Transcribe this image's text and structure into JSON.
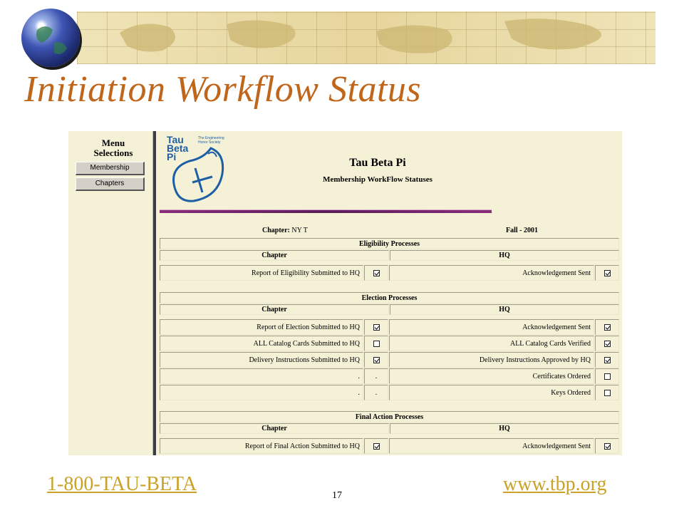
{
  "slide": {
    "title": "Initiation Workflow Status",
    "footer_phone": "1-800-TAU-BETA",
    "footer_url": "www.tbp.org",
    "page_number": "17"
  },
  "menu": {
    "heading_line1": "Menu",
    "heading_line2": "Selections",
    "items": [
      {
        "label": "Membership"
      },
      {
        "label": "Chapters"
      }
    ]
  },
  "logo": {
    "line1": "Tau",
    "line2": "Beta",
    "line3": "Pi",
    "tagline": "The Engineering Honor Society"
  },
  "header": {
    "org_name": "Tau Beta Pi",
    "subtitle": "Membership WorkFlow Statuses",
    "chapter_label": "Chapter:",
    "chapter_value": "NY T",
    "term": "Fall - 2001"
  },
  "sections": [
    {
      "title": "Eligibility Processes",
      "col_chapter": "Chapter",
      "col_hq": "HQ",
      "rows": [
        {
          "chapter_text": "Report of Eligibility Submitted to HQ",
          "chapter_checked": true,
          "hq_text": "Acknowledgement Sent",
          "hq_checked": true
        }
      ]
    },
    {
      "title": "Election Processes",
      "col_chapter": "Chapter",
      "col_hq": "HQ",
      "rows": [
        {
          "chapter_text": "Report of Election Submitted to HQ",
          "chapter_checked": true,
          "hq_text": "Acknowledgement Sent",
          "hq_checked": true
        },
        {
          "chapter_text": "ALL Catalog Cards Submitted to HQ",
          "chapter_checked": false,
          "hq_text": "ALL Catalog Cards Verified",
          "hq_checked": true
        },
        {
          "chapter_text": "Delivery Instructions Submitted to HQ",
          "chapter_checked": true,
          "hq_text": "Delivery Instructions Approved by HQ",
          "hq_checked": true
        },
        {
          "chapter_text": ".",
          "chapter_checked": null,
          "chapter_box_text": ".",
          "hq_text": "Certificates Ordered",
          "hq_checked": false
        },
        {
          "chapter_text": ".",
          "chapter_checked": null,
          "chapter_box_text": ".",
          "hq_text": "Keys Ordered",
          "hq_checked": false
        }
      ]
    },
    {
      "title": "Final Action Processes",
      "col_chapter": "Chapter",
      "col_hq": "HQ",
      "rows": [
        {
          "chapter_text": "Report of Final Action Submitted to HQ",
          "chapter_checked": true,
          "hq_text": "Acknowledgement Sent",
          "hq_checked": true
        }
      ]
    }
  ],
  "colors": {
    "title": "#c0661b",
    "footer_link": "#c9a227",
    "panel_bg": "#f5f1d7",
    "logo_blue": "#1d5fa5",
    "rule_purple": "#5a1d5a"
  }
}
